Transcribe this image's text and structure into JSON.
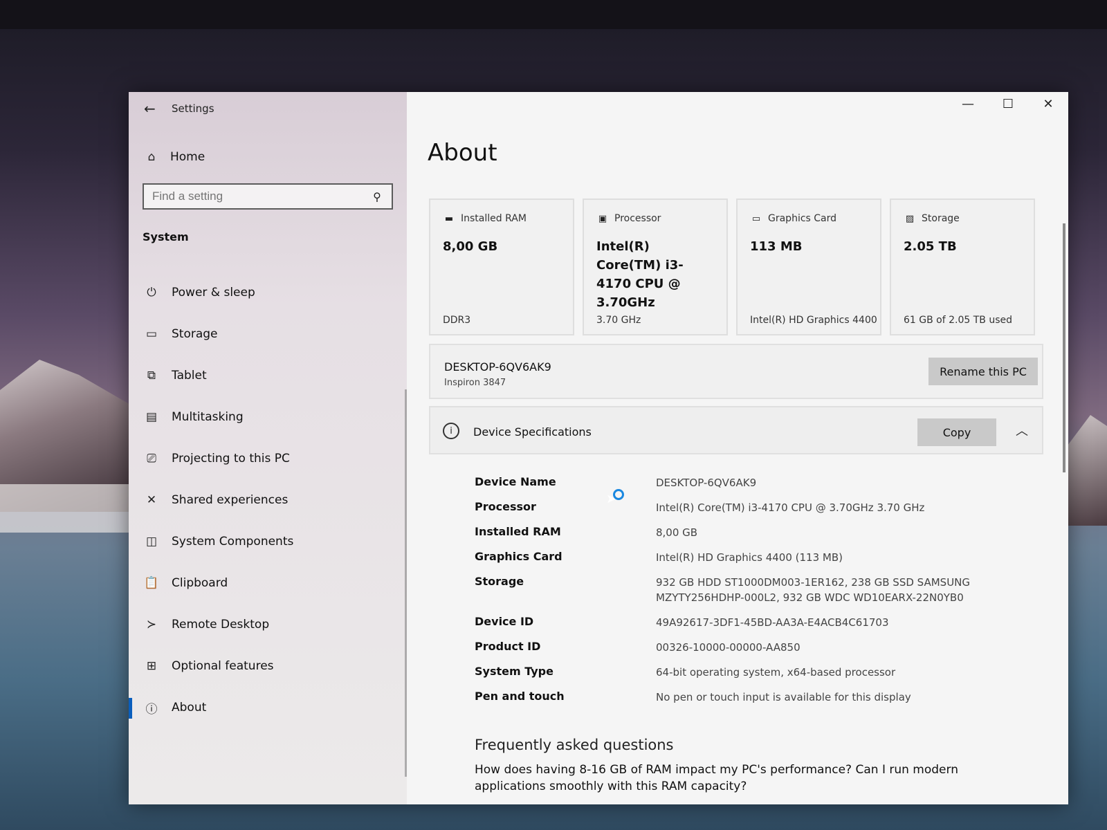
{
  "window": {
    "app_title": "Settings",
    "minimize": "—",
    "maximize": "☐",
    "close": "✕"
  },
  "sidebar": {
    "home": "Home",
    "search_placeholder": "Find a setting",
    "section": "System",
    "items": [
      {
        "label": "Power & sleep",
        "icon": "power-icon"
      },
      {
        "label": "Storage",
        "icon": "storage-icon"
      },
      {
        "label": "Tablet",
        "icon": "tablet-icon"
      },
      {
        "label": "Multitasking",
        "icon": "multitasking-icon"
      },
      {
        "label": "Projecting to this PC",
        "icon": "projecting-icon"
      },
      {
        "label": "Shared experiences",
        "icon": "shared-icon"
      },
      {
        "label": "System Components",
        "icon": "components-icon"
      },
      {
        "label": "Clipboard",
        "icon": "clipboard-icon"
      },
      {
        "label": "Remote Desktop",
        "icon": "remote-icon"
      },
      {
        "label": "Optional features",
        "icon": "features-icon"
      },
      {
        "label": "About",
        "icon": "info-icon",
        "active": true
      }
    ]
  },
  "main": {
    "title": "About",
    "cards": [
      {
        "label": "Installed RAM",
        "value": "8,00 GB",
        "sub": "DDR3",
        "icon": "ram-icon"
      },
      {
        "label": "Processor",
        "value": "Intel(R) Core(TM) i3-4170 CPU @ 3.70GHz",
        "sub": "3.70 GHz",
        "icon": "processor-icon"
      },
      {
        "label": "Graphics Card",
        "value": "113 MB",
        "sub": "Intel(R) HD Graphics 4400",
        "icon": "gpu-icon"
      },
      {
        "label": "Storage",
        "value": "2.05 TB",
        "sub": "61 GB of 2.05 TB used",
        "icon": "disk-icon"
      }
    ],
    "pc": {
      "name": "DESKTOP-6QV6AK9",
      "model": "Inspiron 3847",
      "rename_label": "Rename this PC"
    },
    "specs": {
      "title": "Device Specifications",
      "copy_label": "Copy",
      "rows": [
        {
          "key": "Device Name",
          "value": "DESKTOP-6QV6AK9"
        },
        {
          "key": "Processor",
          "value": "Intel(R) Core(TM) i3-4170 CPU @ 3.70GHz   3.70 GHz"
        },
        {
          "key": "Installed RAM",
          "value": "8,00 GB"
        },
        {
          "key": "Graphics Card",
          "value": "Intel(R) HD Graphics 4400 (113 MB)"
        },
        {
          "key": "Storage",
          "value": "932 GB HDD ST1000DM003-1ER162, 238 GB SSD SAMSUNG MZYTY256HDHP-000L2, 932 GB WDC WD10EARX-22N0YB0"
        },
        {
          "key": "Device ID",
          "value": "49A92617-3DF1-45BD-AA3A-E4ACB4C61703"
        },
        {
          "key": "Product ID",
          "value": "00326-10000-00000-AA850"
        },
        {
          "key": "System Type",
          "value": "64-bit operating system, x64-based processor"
        },
        {
          "key": "Pen and touch",
          "value": "No pen or touch input is available for this display"
        }
      ]
    },
    "faq": {
      "title": "Frequently asked questions",
      "question": "How does having 8-16 GB of RAM impact my PC's performance? Can I run modern applications smoothly with this RAM capacity?"
    }
  }
}
